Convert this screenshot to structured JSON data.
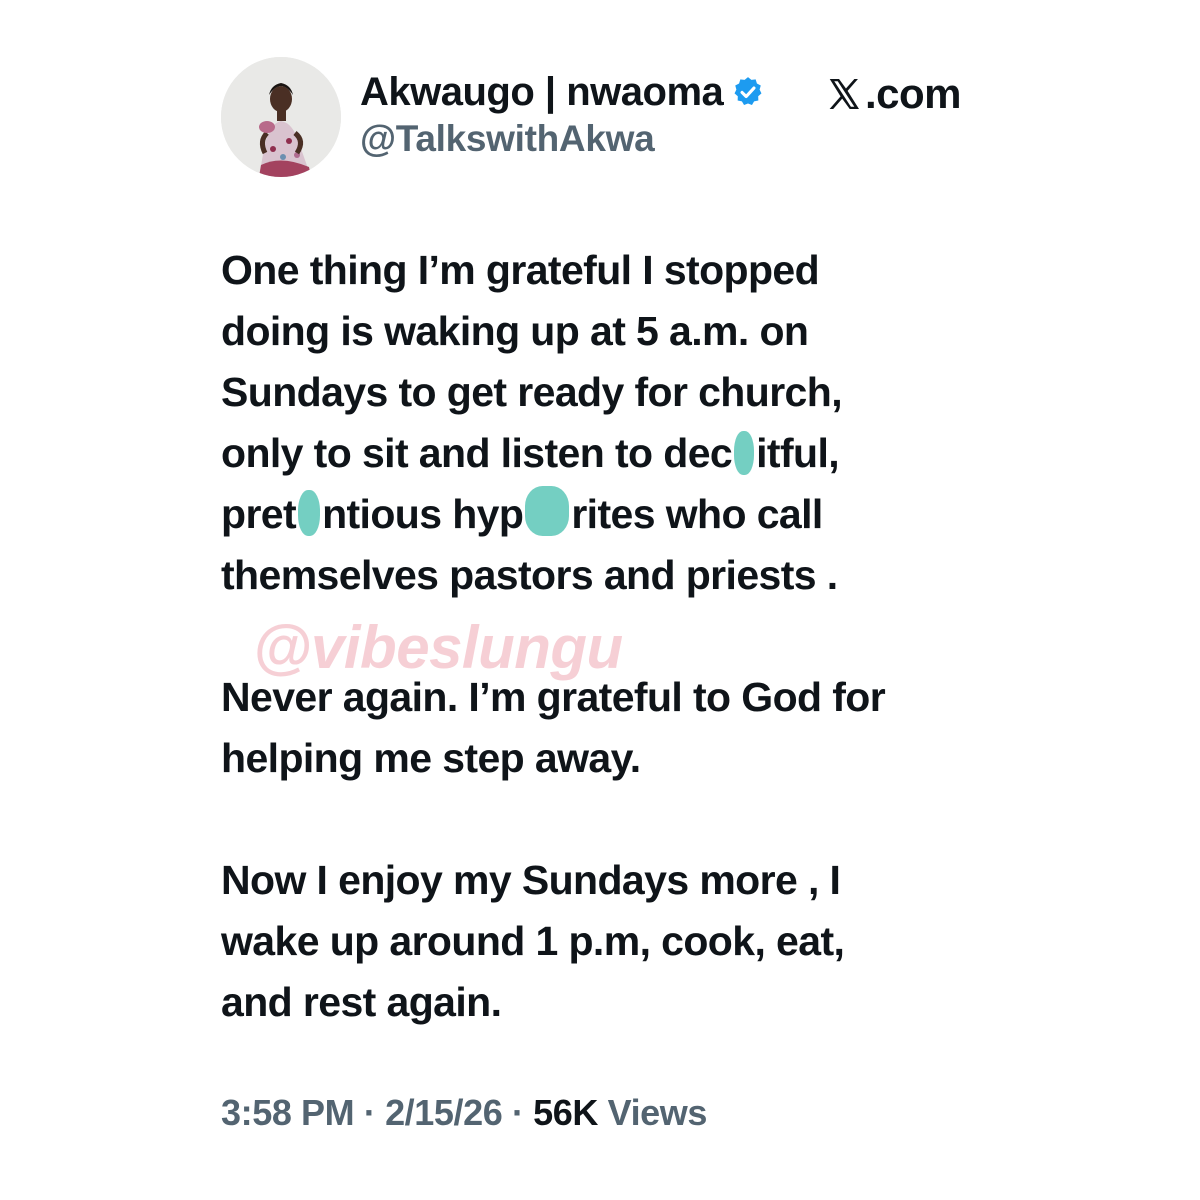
{
  "author": {
    "display_name": "Akwaugo | nwaoma",
    "handle": "@TalkswithAkwa",
    "verified_icon": "verified-badge-icon",
    "avatar_icon": "profile-photo"
  },
  "source": {
    "logo_icon": "x-logo-icon",
    "text": ".com"
  },
  "tweet": {
    "p1": {
      "l1": "One thing I’m grateful I stopped",
      "l2": "doing is waking up at 5 a.m. on",
      "l3": "Sundays to get ready for church,",
      "l4a": "only to sit and listen to dec",
      "l4b": "itful,",
      "l5a": "pret",
      "l5b": "ntious hyp",
      "l5c": "rites who call",
      "l6": "themselves pastors and priests ."
    },
    "p2": {
      "l1": "Never again. I’m grateful to God for",
      "l2": "helping me step away."
    },
    "p3": {
      "l1": "Now I enjoy my Sundays more , I",
      "l2": "wake up around 1 p.m, cook, eat,",
      "l3": "and rest again."
    }
  },
  "watermark": "@vibeslungu",
  "meta": {
    "time": "3:58 PM",
    "sep1": " · ",
    "date": "2/15/26",
    "sep2": " · ",
    "views_count": "56K",
    "views_label": " Views"
  },
  "colors": {
    "text": "#0f1419",
    "secondary": "#536471",
    "verified": "#1d9bf0",
    "censor_mark": "#74cfc2",
    "watermark": "#efa8b2"
  }
}
